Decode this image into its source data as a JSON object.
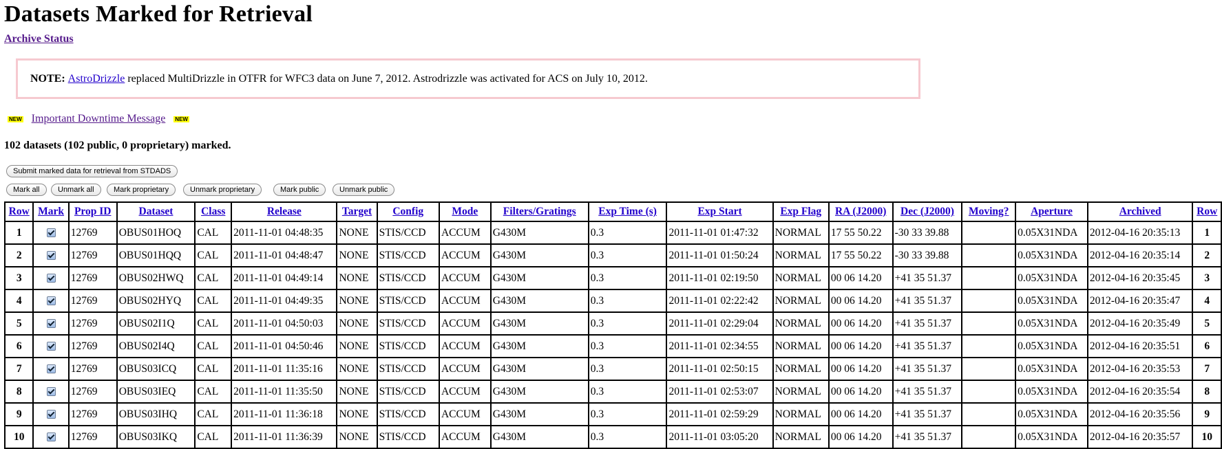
{
  "page": {
    "title": "Datasets Marked for Retrieval",
    "archive_status_link": "Archive Status"
  },
  "note": {
    "label": "NOTE:",
    "link": "AstroDrizzle",
    "text": "replaced MultiDrizzle in OTFR for WFC3 data on June 7, 2012. Astrodrizzle was activated for ACS on July 10, 2012."
  },
  "downtime": {
    "badge": "NEW",
    "link": "Important Downtime Message"
  },
  "summary": "102 datasets (102 public, 0 proprietary) marked.",
  "buttons": {
    "submit": "Submit marked data for retrieval from STDADS",
    "mark_all": "Mark all",
    "unmark_all": "Unmark all",
    "mark_proprietary": "Mark proprietary",
    "unmark_proprietary": "Unmark proprietary",
    "mark_public": "Mark public",
    "unmark_public": "Unmark public"
  },
  "table": {
    "headers": [
      "Row",
      "Mark",
      "Prop ID",
      "Dataset",
      "Class",
      "Release",
      "Target",
      "Config",
      "Mode",
      "Filters/Gratings",
      "Exp Time (s)",
      "Exp Start",
      "Exp Flag",
      "RA (J2000)",
      "Dec (J2000)",
      "Moving?",
      "Aperture",
      "Archived",
      "Row"
    ],
    "rows": [
      {
        "row": "1",
        "marked": true,
        "prop_id": "12769",
        "dataset": "OBUS01HOQ",
        "class": "CAL",
        "release": "2011-11-01 04:48:35",
        "target": "NONE",
        "config": "STIS/CCD",
        "mode": "ACCUM",
        "filters": "G430M",
        "exp_time": "0.3",
        "exp_start": "2011-11-01 01:47:32",
        "exp_flag": "NORMAL",
        "ra": "17 55 50.22",
        "dec": "-30 33 39.88",
        "moving": "",
        "aperture": "0.05X31NDA",
        "archived": "2012-04-16 20:35:13"
      },
      {
        "row": "2",
        "marked": true,
        "prop_id": "12769",
        "dataset": "OBUS01HQQ",
        "class": "CAL",
        "release": "2011-11-01 04:48:47",
        "target": "NONE",
        "config": "STIS/CCD",
        "mode": "ACCUM",
        "filters": "G430M",
        "exp_time": "0.3",
        "exp_start": "2011-11-01 01:50:24",
        "exp_flag": "NORMAL",
        "ra": "17 55 50.22",
        "dec": "-30 33 39.88",
        "moving": "",
        "aperture": "0.05X31NDA",
        "archived": "2012-04-16 20:35:14"
      },
      {
        "row": "3",
        "marked": true,
        "prop_id": "12769",
        "dataset": "OBUS02HWQ",
        "class": "CAL",
        "release": "2011-11-01 04:49:14",
        "target": "NONE",
        "config": "STIS/CCD",
        "mode": "ACCUM",
        "filters": "G430M",
        "exp_time": "0.3",
        "exp_start": "2011-11-01 02:19:50",
        "exp_flag": "NORMAL",
        "ra": "00 06 14.20",
        "dec": "+41 35 51.37",
        "moving": "",
        "aperture": "0.05X31NDA",
        "archived": "2012-04-16 20:35:45"
      },
      {
        "row": "4",
        "marked": true,
        "prop_id": "12769",
        "dataset": "OBUS02HYQ",
        "class": "CAL",
        "release": "2011-11-01 04:49:35",
        "target": "NONE",
        "config": "STIS/CCD",
        "mode": "ACCUM",
        "filters": "G430M",
        "exp_time": "0.3",
        "exp_start": "2011-11-01 02:22:42",
        "exp_flag": "NORMAL",
        "ra": "00 06 14.20",
        "dec": "+41 35 51.37",
        "moving": "",
        "aperture": "0.05X31NDA",
        "archived": "2012-04-16 20:35:47"
      },
      {
        "row": "5",
        "marked": true,
        "prop_id": "12769",
        "dataset": "OBUS02I1Q",
        "class": "CAL",
        "release": "2011-11-01 04:50:03",
        "target": "NONE",
        "config": "STIS/CCD",
        "mode": "ACCUM",
        "filters": "G430M",
        "exp_time": "0.3",
        "exp_start": "2011-11-01 02:29:04",
        "exp_flag": "NORMAL",
        "ra": "00 06 14.20",
        "dec": "+41 35 51.37",
        "moving": "",
        "aperture": "0.05X31NDA",
        "archived": "2012-04-16 20:35:49"
      },
      {
        "row": "6",
        "marked": true,
        "prop_id": "12769",
        "dataset": "OBUS02I4Q",
        "class": "CAL",
        "release": "2011-11-01 04:50:46",
        "target": "NONE",
        "config": "STIS/CCD",
        "mode": "ACCUM",
        "filters": "G430M",
        "exp_time": "0.3",
        "exp_start": "2011-11-01 02:34:55",
        "exp_flag": "NORMAL",
        "ra": "00 06 14.20",
        "dec": "+41 35 51.37",
        "moving": "",
        "aperture": "0.05X31NDA",
        "archived": "2012-04-16 20:35:51"
      },
      {
        "row": "7",
        "marked": true,
        "prop_id": "12769",
        "dataset": "OBUS03ICQ",
        "class": "CAL",
        "release": "2011-11-01 11:35:16",
        "target": "NONE",
        "config": "STIS/CCD",
        "mode": "ACCUM",
        "filters": "G430M",
        "exp_time": "0.3",
        "exp_start": "2011-11-01 02:50:15",
        "exp_flag": "NORMAL",
        "ra": "00 06 14.20",
        "dec": "+41 35 51.37",
        "moving": "",
        "aperture": "0.05X31NDA",
        "archived": "2012-04-16 20:35:53"
      },
      {
        "row": "8",
        "marked": true,
        "prop_id": "12769",
        "dataset": "OBUS03IEQ",
        "class": "CAL",
        "release": "2011-11-01 11:35:50",
        "target": "NONE",
        "config": "STIS/CCD",
        "mode": "ACCUM",
        "filters": "G430M",
        "exp_time": "0.3",
        "exp_start": "2011-11-01 02:53:07",
        "exp_flag": "NORMAL",
        "ra": "00 06 14.20",
        "dec": "+41 35 51.37",
        "moving": "",
        "aperture": "0.05X31NDA",
        "archived": "2012-04-16 20:35:54"
      },
      {
        "row": "9",
        "marked": true,
        "prop_id": "12769",
        "dataset": "OBUS03IHQ",
        "class": "CAL",
        "release": "2011-11-01 11:36:18",
        "target": "NONE",
        "config": "STIS/CCD",
        "mode": "ACCUM",
        "filters": "G430M",
        "exp_time": "0.3",
        "exp_start": "2011-11-01 02:59:29",
        "exp_flag": "NORMAL",
        "ra": "00 06 14.20",
        "dec": "+41 35 51.37",
        "moving": "",
        "aperture": "0.05X31NDA",
        "archived": "2012-04-16 20:35:56"
      },
      {
        "row": "10",
        "marked": true,
        "prop_id": "12769",
        "dataset": "OBUS03IKQ",
        "class": "CAL",
        "release": "2011-11-01 11:36:39",
        "target": "NONE",
        "config": "STIS/CCD",
        "mode": "ACCUM",
        "filters": "G430M",
        "exp_time": "0.3",
        "exp_start": "2011-11-01 03:05:20",
        "exp_flag": "NORMAL",
        "ra": "00 06 14.20",
        "dec": "+41 35 51.37",
        "moving": "",
        "aperture": "0.05X31NDA",
        "archived": "2012-04-16 20:35:57"
      }
    ]
  },
  "colors": {
    "link_visited": "#551a8b",
    "link": "#2200cc",
    "note_border": "#f6c9d0",
    "badge_bg": "#ffff00"
  }
}
